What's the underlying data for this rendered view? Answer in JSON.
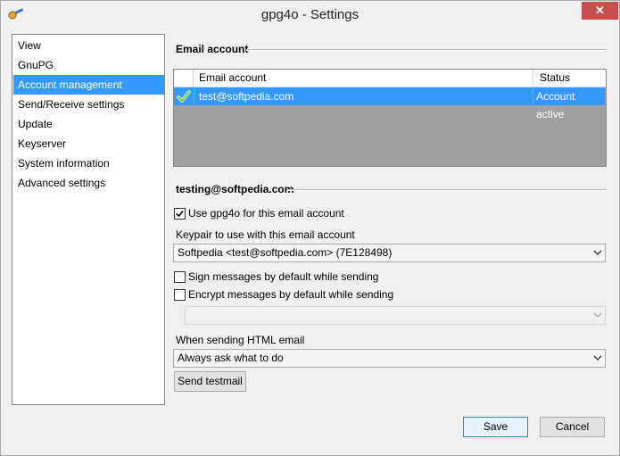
{
  "window": {
    "title": "gpg4o - Settings",
    "close_glyph": "✕",
    "icon": "key-icon"
  },
  "nav": {
    "items": [
      {
        "label": "View",
        "selected": false
      },
      {
        "label": "GnuPG",
        "selected": false
      },
      {
        "label": "Account management",
        "selected": true
      },
      {
        "label": "Send/Receive settings",
        "selected": false
      },
      {
        "label": "Update",
        "selected": false
      },
      {
        "label": "Keyserver",
        "selected": false
      },
      {
        "label": "System information",
        "selected": false
      },
      {
        "label": "Advanced settings",
        "selected": false
      }
    ]
  },
  "email_section": {
    "title": "Email account",
    "columns": [
      "Email account",
      "Status"
    ],
    "rows": [
      {
        "email": "test@softpedia.com",
        "status": "Account active",
        "icon": "check-icon"
      }
    ]
  },
  "account_section": {
    "title": "testing@softpedia.com",
    "use_gpg4o": {
      "label": "Use gpg4o for this email account",
      "checked": true
    },
    "keypair": {
      "label": "Keypair to use with this email account",
      "value": "Softpedia <test@softpedia.com> (7E128498)"
    },
    "sign_default": {
      "label": "Sign messages by default while sending",
      "checked": false
    },
    "encrypt_default": {
      "label": "Encrypt messages by default while sending",
      "checked": false
    },
    "encrypt_option": {
      "value": ""
    },
    "html_email": {
      "label": "When sending HTML email",
      "value": "Always ask what to do"
    },
    "send_testmail_label": "Send testmail"
  },
  "footer": {
    "save_label": "Save",
    "cancel_label": "Cancel"
  },
  "colors": {
    "selection": "#3399ff",
    "close": "#c7504f",
    "grid_bg": "#a0a0a0"
  }
}
